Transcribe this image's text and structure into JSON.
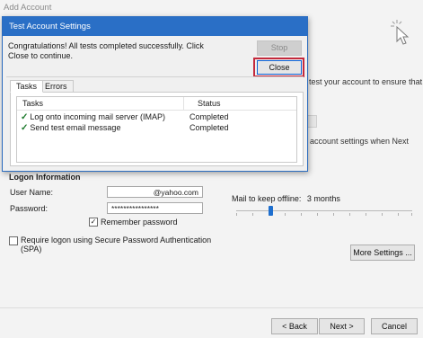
{
  "window": {
    "title": "Add Account"
  },
  "background": {
    "test_text_fragment": "test your account to ensure that",
    "settings_text_fragment": "account settings when Next",
    "logon": {
      "section_title": "Logon Information",
      "user_name_label": "User Name:",
      "user_name_value": "@yahoo.com",
      "password_label": "Password:",
      "password_value": "****************",
      "remember_label": "Remember password",
      "remember_checked": true,
      "spa_label_line1": "Require logon using Secure Password Authentication",
      "spa_label_line2": "(SPA)",
      "spa_checked": false
    },
    "offline": {
      "label": "Mail to keep offline:",
      "value": "3 months",
      "level_fraction": 0.18
    },
    "buttons": {
      "more_settings": "More Settings ...",
      "back": "< Back",
      "next": "Next >",
      "cancel": "Cancel"
    }
  },
  "dialog": {
    "title": "Test Account Settings",
    "message": "Congratulations! All tests completed successfully. Click Close to continue.",
    "stop_label": "Stop",
    "close_label": "Close",
    "tabs": [
      {
        "label": "Tasks",
        "active": true
      },
      {
        "label": "Errors",
        "active": false
      }
    ],
    "table": {
      "headers": {
        "tasks": "Tasks",
        "status": "Status"
      },
      "rows": [
        {
          "task": "Log onto incoming mail server (IMAP)",
          "status": "Completed"
        },
        {
          "task": "Send test email message",
          "status": "Completed"
        }
      ]
    }
  },
  "colors": {
    "titlebar": "#2a6fc6",
    "highlight": "#c4293c",
    "check": "#1d7a2c",
    "slider": "#1e6fcf"
  },
  "icons": {
    "check": "check-icon",
    "cursor": "click-cursor-icon"
  }
}
